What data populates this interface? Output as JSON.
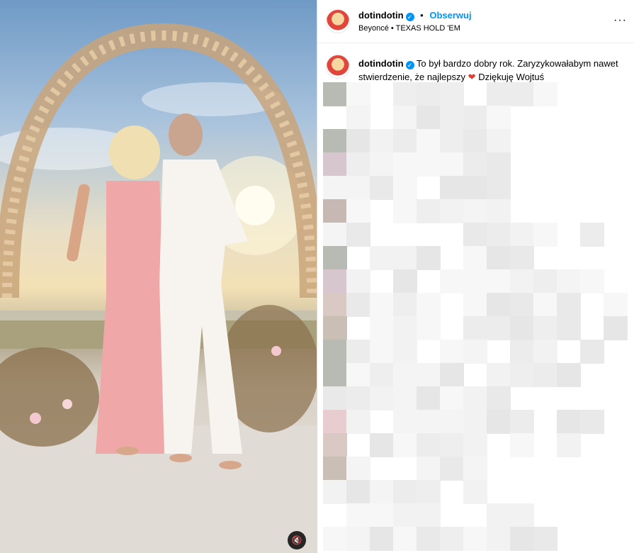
{
  "post": {
    "username": "dotindotin",
    "verified": true,
    "separator": "•",
    "follow_label": "Obserwuj",
    "audio_artist": "Beyoncé",
    "audio_separator": "•",
    "audio_track": "TEXAS HOLD 'EM",
    "more_label": "···"
  },
  "caption": {
    "username": "dotindotin",
    "text_main": "To był bardzo dobry rok. Zaryzykowałabym nawet stwierdzenie, że najlepszy",
    "heart": "❤",
    "text_end": "Dziękuję Wojtuś"
  },
  "media": {
    "mute_icon": "🔇"
  },
  "colors": {
    "accent": "#0095f6",
    "heart": "#e03c31"
  }
}
